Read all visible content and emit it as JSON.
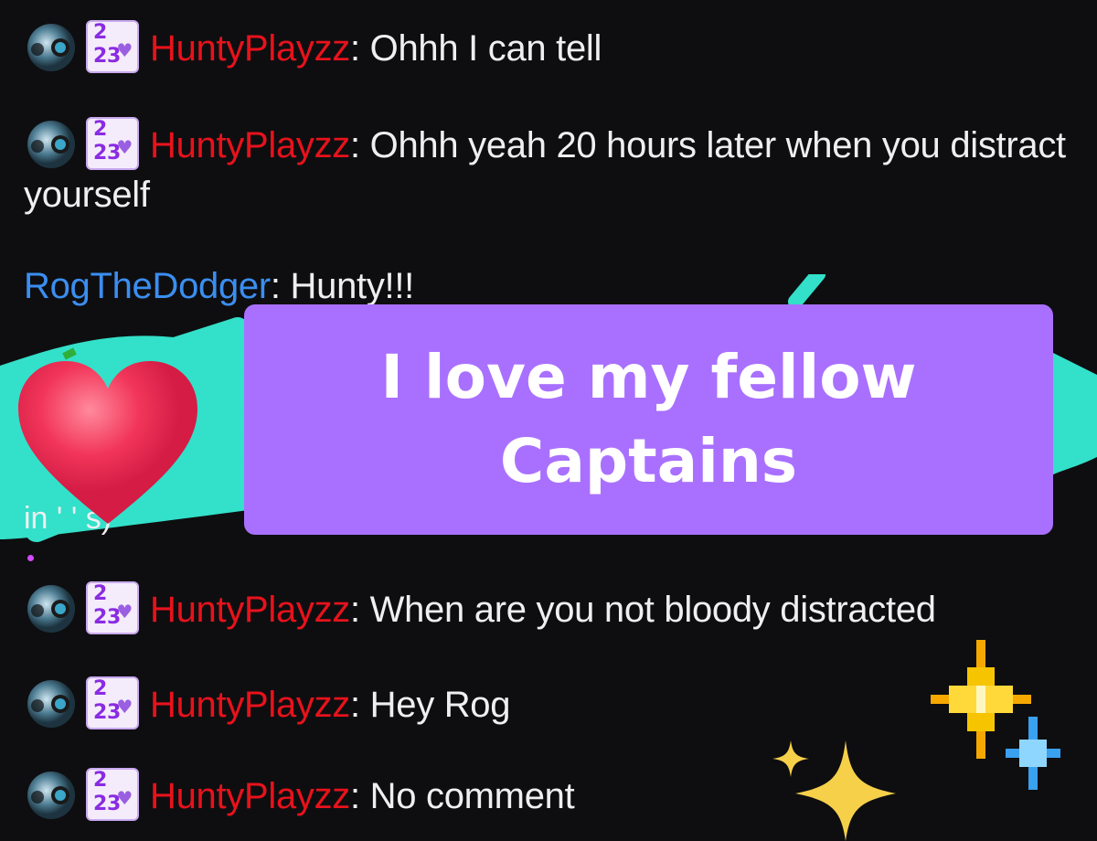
{
  "chat": {
    "messages": [
      {
        "user": "HuntyPlayzz",
        "user_color": "#e8121b",
        "text": "Ohhh I can tell",
        "badges": [
          "pokeball-badge",
          "2023-sub-badge"
        ]
      },
      {
        "user": "HuntyPlayzz",
        "user_color": "#e8121b",
        "text": "Ohhh yeah 20 hours later when you distract yourself",
        "badges": [
          "pokeball-badge",
          "2023-sub-badge"
        ]
      },
      {
        "user": "RogTheDodger",
        "user_color": "#3b8ef0",
        "text": "Hunty!!!",
        "badges": []
      },
      {
        "user": "HuntyPlayzz",
        "user_color": "#e8121b",
        "text": "When are you not bloody distracted",
        "badges": [
          "pokeball-badge",
          "2023-sub-badge"
        ]
      },
      {
        "user": "HuntyPlayzz",
        "user_color": "#e8121b",
        "text": "Hey Rog",
        "badges": [
          "pokeball-badge",
          "2023-sub-badge"
        ]
      },
      {
        "user": "HuntyPlayzz",
        "user_color": "#e8121b",
        "text": "No comment",
        "badges": [
          "pokeball-badge",
          "2023-sub-badge"
        ]
      }
    ],
    "separator": ": ",
    "sub_badge": {
      "top": "2",
      "bottom": "23"
    },
    "obscured_fragment": "in ' ' s)"
  },
  "overlay": {
    "caption": "I love my fellow Captains",
    "caption_bg": "#a970ff",
    "heart_icon": "heart-emoji",
    "scribble_color": "#33e0c9",
    "sparkles": [
      "pixel-sparkle-gold",
      "pixel-sparkle-blue",
      "sparkles-emoji"
    ]
  },
  "colors": {
    "background": "#0e0e10",
    "text": "#efeff1"
  }
}
